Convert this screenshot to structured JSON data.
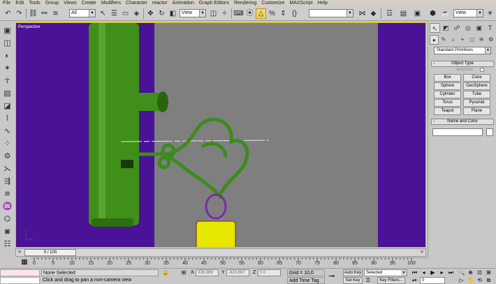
{
  "menu": [
    "File",
    "Edit",
    "Tools",
    "Group",
    "Views",
    "Create",
    "Modifiers",
    "Character",
    "reactor",
    "Animation",
    "Graph Editors",
    "Rendering",
    "Customize",
    "MAXScript",
    "Help"
  ],
  "toolbar": {
    "selection_filter": "All",
    "ref_coord_system": "View",
    "named_selection": "",
    "render_view": "View"
  },
  "viewport": {
    "label": "Perspective",
    "colors": {
      "background": "#7f7f7f",
      "backdrop": "#4a1296",
      "door": "#3f8f1a",
      "key": "#3c8c1c",
      "ring": "#7a2ba6",
      "tag": "#e6e600"
    }
  },
  "time_slider": {
    "position": "0 / 100",
    "prev": "<",
    "next": ">"
  },
  "trackbar": {
    "ticks": [
      "0",
      "5",
      "10",
      "15",
      "20",
      "25",
      "30",
      "35",
      "40",
      "45",
      "50",
      "55",
      "60",
      "65",
      "70",
      "75",
      "80",
      "85",
      "90",
      "95",
      "100"
    ]
  },
  "status": {
    "selection": "None Selected",
    "prompt": "Click and drag to pan a non-camera view",
    "x_label": "X",
    "x_value": "328.389",
    "y_label": "Y",
    "y_value": "-623.667",
    "z_label": "Z",
    "z_value": "0.0",
    "grid": "Grid = 10.0",
    "add_time_tag": "Add Time Tag",
    "auto_key": "Auto Key",
    "set_key": "Set Key",
    "key_mode_dropdown": "Selected",
    "key_filters": "Key Filters...",
    "current_frame": "0"
  },
  "command_panel": {
    "category": "Standard Primitives",
    "object_type_title": "Object Type",
    "autogrid": "AutoGrid",
    "objects": [
      "Box",
      "Cone",
      "Sphere",
      "GeoSphere",
      "Cylinder",
      "Tube",
      "Torus",
      "Pyramid",
      "Teapot",
      "Plane"
    ],
    "name_color_title": "Name and Color",
    "rollout_minus": "-"
  }
}
